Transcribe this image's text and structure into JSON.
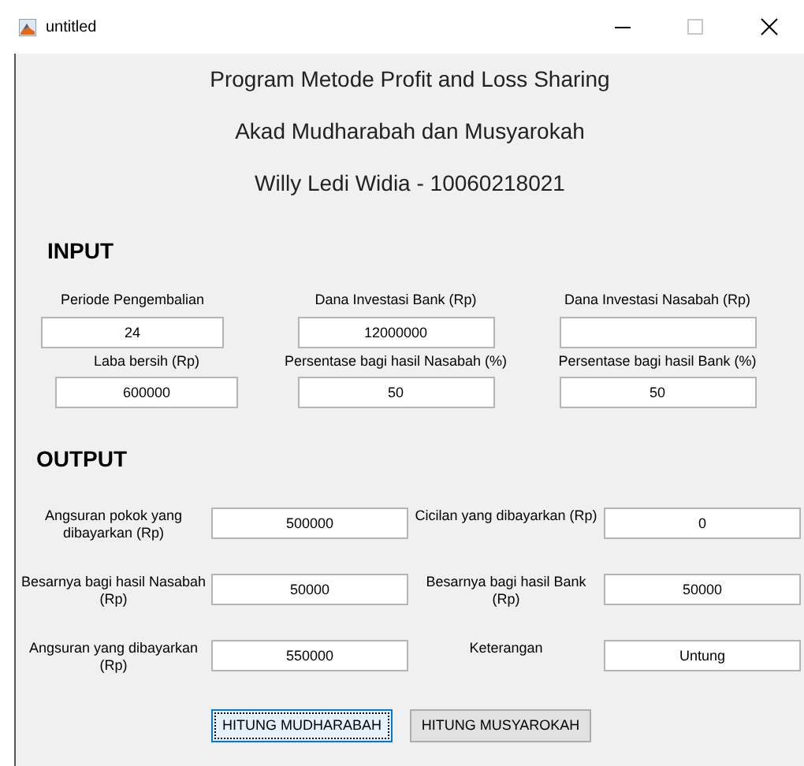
{
  "window": {
    "title": "untitled"
  },
  "header": [
    "Program Metode Profit and Loss Sharing",
    "Akad Mudharabah dan Musyarokah",
    "Willy Ledi Widia - 10060218021"
  ],
  "input": {
    "heading": "INPUT",
    "fields": [
      {
        "label": "Periode Pengembalian",
        "value": "24"
      },
      {
        "label": "Dana Investasi Bank (Rp)",
        "value": "12000000"
      },
      {
        "label": "Dana Investasi Nasabah (Rp)"
      },
      {
        "label": "Laba bersih (Rp)",
        "value": "600000"
      },
      {
        "label": "Persentase bagi hasil Nasabah (%)",
        "value": "50"
      },
      {
        "label": "Persentase bagi hasil Bank (%)",
        "value": "50"
      }
    ]
  },
  "output": {
    "heading": "OUTPUT",
    "fields": [
      {
        "label": "Angsuran pokok yang dibayarkan (Rp)",
        "value": "500000"
      },
      {
        "label": "Cicilan yang dibayarkan (Rp)",
        "value": "0"
      },
      {
        "label": "Besarnya bagi hasil Nasabah (Rp)",
        "value": "50000"
      },
      {
        "label": "Besarnya bagi hasil Bank (Rp)",
        "value": "50000"
      },
      {
        "label": "Angsuran yang dibayarkan (Rp)",
        "value": "550000"
      },
      {
        "label": "Keterangan",
        "value": "Untung"
      }
    ]
  },
  "buttons": [
    {
      "label": "HITUNG MUDHARABAH",
      "focused": true
    },
    {
      "label": "HITUNG MUSYAROKAH",
      "focused": false
    }
  ]
}
